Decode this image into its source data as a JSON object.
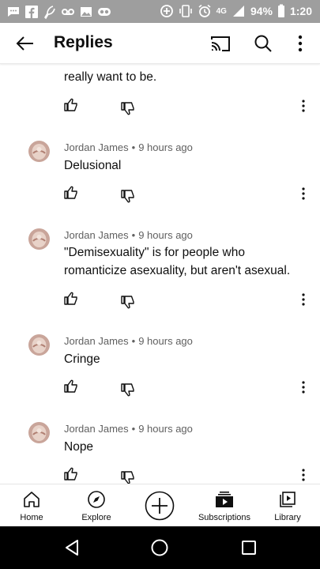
{
  "status_bar": {
    "battery": "94%",
    "time": "1:20",
    "network": "4G",
    "left_icons": [
      "message-icon",
      "facebook-icon",
      "feather-icon",
      "voicemail-icon",
      "gallery-icon",
      "infinity-icon"
    ],
    "right_icons": [
      "data-saver-icon",
      "vibrate-icon",
      "alarm-icon",
      "signal-icon",
      "battery-icon"
    ]
  },
  "app_bar": {
    "title": "Replies",
    "icons": [
      "back-arrow-icon",
      "cast-icon",
      "search-icon",
      "more-vertical-icon"
    ]
  },
  "partial_comment": {
    "line_cut": "... ..... . . ...... ..... .. .......",
    "text": "really want to be."
  },
  "replies": [
    {
      "author": "Jordan James",
      "time": "9 hours ago",
      "text": "Delusional"
    },
    {
      "author": "Jordan James",
      "time": "9 hours ago",
      "text": "\"Demisexuality\" is for people who romanticize asexuality, but aren't asexual."
    },
    {
      "author": "Jordan James",
      "time": "9 hours ago",
      "text": "Cringe"
    },
    {
      "author": "Jordan James",
      "time": "9 hours ago",
      "text": "Nope"
    }
  ],
  "separator": "•",
  "bottom_nav": {
    "home": "Home",
    "explore": "Explore",
    "subscriptions": "Subscriptions",
    "library": "Library"
  },
  "colors": {
    "status_bar_bg": "#9e9e9e",
    "meta_text": "#606060",
    "system_nav_bg": "#000000"
  }
}
